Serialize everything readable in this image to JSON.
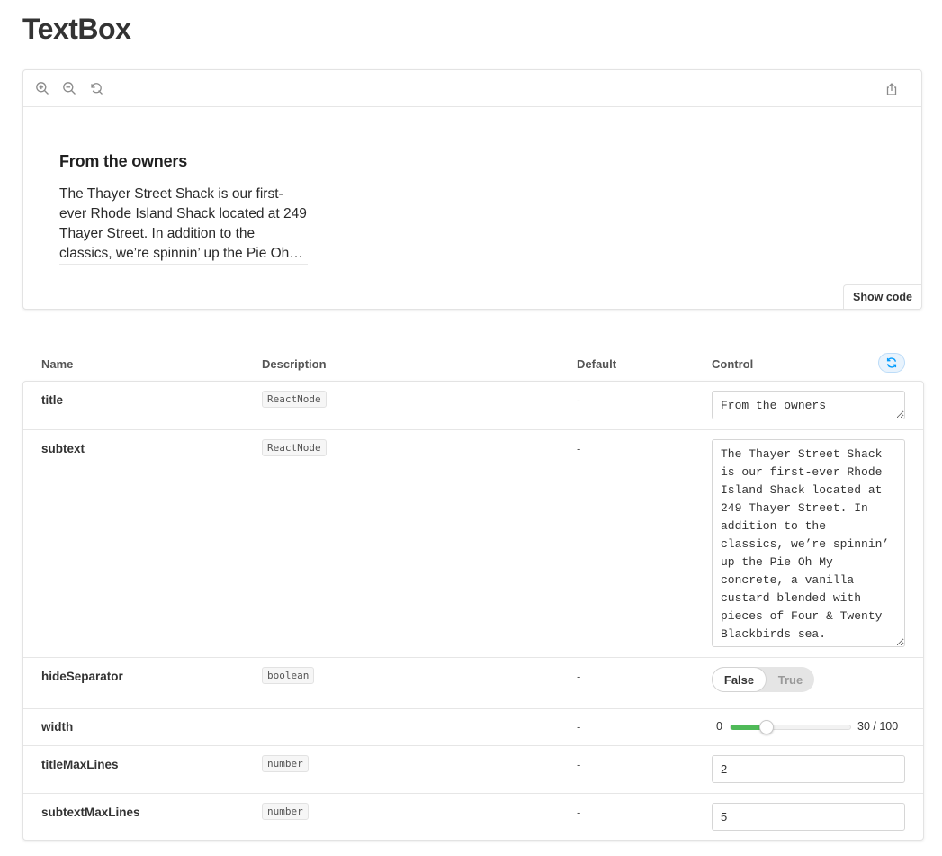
{
  "page": {
    "title": "TextBox"
  },
  "preview": {
    "toolbar": {
      "zoom_in_icon": "zoom-in-icon",
      "zoom_out_icon": "zoom-out-icon",
      "reset_zoom_icon": "reset-zoom-icon",
      "share_icon": "share-icon"
    },
    "textbox": {
      "title": "From the owners",
      "subtext": "The Thayer Street Shack is our first-ever Rhode Island Shack located at 249 Thayer Street. In addition to the classics, we’re spinnin’ up the Pie Oh My concrete, a vanilla custard blended with pieces of Four & Twenty Blackbirds sea."
    },
    "show_code_label": "Show code"
  },
  "args_table": {
    "headers": {
      "name": "Name",
      "description": "Description",
      "default": "Default",
      "control": "Control"
    },
    "reset_icon": "reset-icon",
    "accent_color": "#029cfd",
    "rows": [
      {
        "name": "title",
        "type": "ReactNode",
        "default": "-",
        "control_value": "From the owners"
      },
      {
        "name": "subtext",
        "type": "ReactNode",
        "default": "-",
        "control_value": "The Thayer Street Shack is our first-ever Rhode Island Shack located at 249 Thayer Street. In addition to the classics, we’re spinnin’ up the Pie Oh My concrete, a vanilla custard blended with pieces of Four & Twenty Blackbirds sea."
      },
      {
        "name": "hideSeparator",
        "type": "boolean",
        "default": "-",
        "toggle_false": "False",
        "toggle_true": "True",
        "value": false
      },
      {
        "name": "width",
        "type": "",
        "default": "-",
        "range_min_label": "0",
        "range_value_label": "30 / 100",
        "min": 0,
        "max": 100,
        "value": 30,
        "fill_color": "#4fba58"
      },
      {
        "name": "titleMaxLines",
        "type": "number",
        "default": "-",
        "control_value": "2"
      },
      {
        "name": "subtextMaxLines",
        "type": "number",
        "default": "-",
        "control_value": "5"
      }
    ]
  }
}
